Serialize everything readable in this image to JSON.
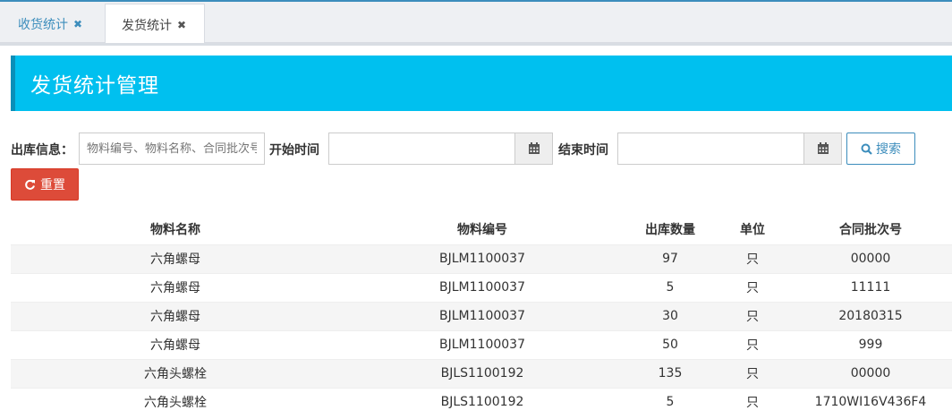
{
  "tabs": [
    {
      "label": "收货统计",
      "close": "✖"
    },
    {
      "label": "发货统计",
      "close": "✖"
    }
  ],
  "header": {
    "title": "发货统计管理"
  },
  "filters": {
    "outbound_label": "出库信息：",
    "outbound_placeholder": "物料编号、物料名称、合同批次号",
    "start_label": "开始时间",
    "end_label": "结束时间",
    "search_label": "搜索",
    "reset_label": "重置"
  },
  "table": {
    "columns": [
      "物料名称",
      "物料编号",
      "出库数量",
      "单位",
      "合同批次号"
    ],
    "rows": [
      [
        "六角螺母",
        "BJLM1100037",
        "97",
        "只",
        "00000"
      ],
      [
        "六角螺母",
        "BJLM1100037",
        "5",
        "只",
        "11111"
      ],
      [
        "六角螺母",
        "BJLM1100037",
        "30",
        "只",
        "20180315"
      ],
      [
        "六角螺母",
        "BJLM1100037",
        "50",
        "只",
        "999"
      ],
      [
        "六角头螺栓",
        "BJLS1100192",
        "135",
        "只",
        "00000"
      ],
      [
        "六角头螺栓",
        "BJLS1100192",
        "5",
        "只",
        "1710WI16V436F4"
      ]
    ]
  }
}
